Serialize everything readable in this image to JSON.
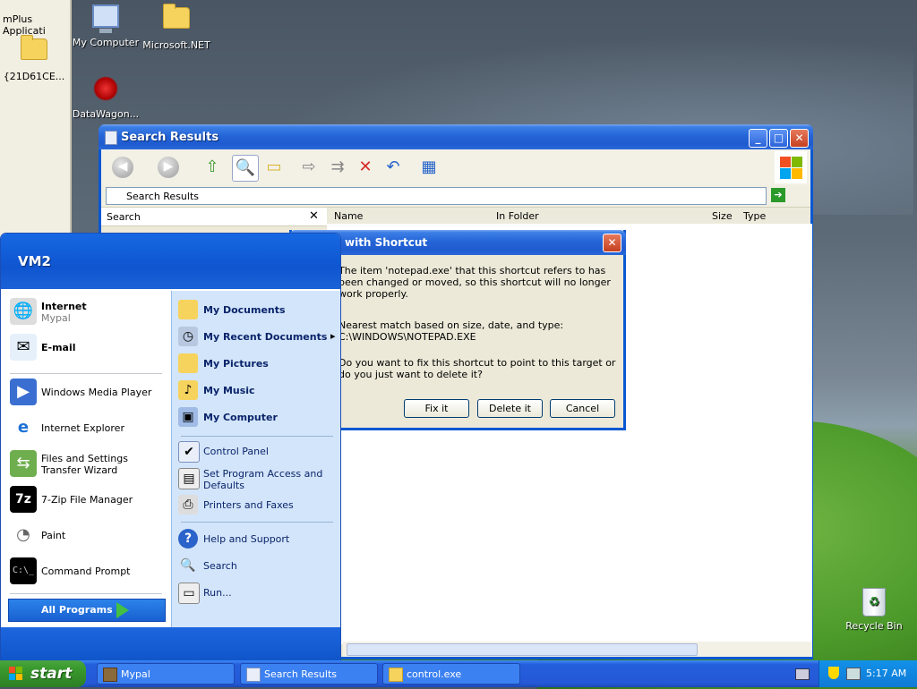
{
  "desktop": {
    "icons": [
      {
        "label": "My Computer"
      },
      {
        "label": "Microsoft.NET"
      },
      {
        "label": "{21D61CE..."
      },
      {
        "label": "DataWagon..."
      },
      {
        "label": "Recycle Bin"
      }
    ],
    "left_window_title": "mPlus Applicati"
  },
  "search_window": {
    "title": "Search Results",
    "address": "Search Results",
    "search_pane_label": "Search",
    "columns": [
      "Name",
      "In Folder",
      "Size",
      "Type"
    ]
  },
  "dialog": {
    "title": "with Shortcut",
    "message1": "The item 'notepad.exe' that this shortcut refers to has been changed or moved, so this shortcut will no longer work properly.",
    "message2": "Nearest match based on size, date, and type:",
    "match_path": "C:\\WINDOWS\\NOTEPAD.EXE",
    "message3": "Do you want to fix this shortcut to point to this target or do you just want to delete it?",
    "buttons": {
      "fix": "Fix it",
      "delete": "Delete it",
      "cancel": "Cancel"
    }
  },
  "start_menu": {
    "user": "VM2",
    "pinned": [
      {
        "label": "Internet",
        "sub": "Mypal"
      },
      {
        "label": "E-mail",
        "sub": ""
      }
    ],
    "recent": [
      {
        "label": "Windows Media Player"
      },
      {
        "label": "Internet Explorer"
      },
      {
        "label": "Files and Settings Transfer Wizard"
      },
      {
        "label": "7-Zip File Manager"
      },
      {
        "label": "Paint"
      },
      {
        "label": "Command Prompt"
      }
    ],
    "all_programs": "All Programs",
    "right": {
      "my_documents": "My Documents",
      "my_recent_documents": "My Recent Documents",
      "my_pictures": "My Pictures",
      "my_music": "My Music",
      "my_computer": "My Computer",
      "control_panel": "Control Panel",
      "set_program_access": "Set Program Access and Defaults",
      "printers": "Printers and Faxes",
      "help": "Help and Support",
      "search": "Search",
      "run": "Run..."
    }
  },
  "taskbar": {
    "start_label": "start",
    "tasks": [
      {
        "label": "Mypal"
      },
      {
        "label": "Search Results"
      },
      {
        "label": "control.exe"
      }
    ],
    "clock": "5:17 AM"
  },
  "colors": {
    "accent": "#245edb",
    "start_green": "#3a9a2e"
  }
}
